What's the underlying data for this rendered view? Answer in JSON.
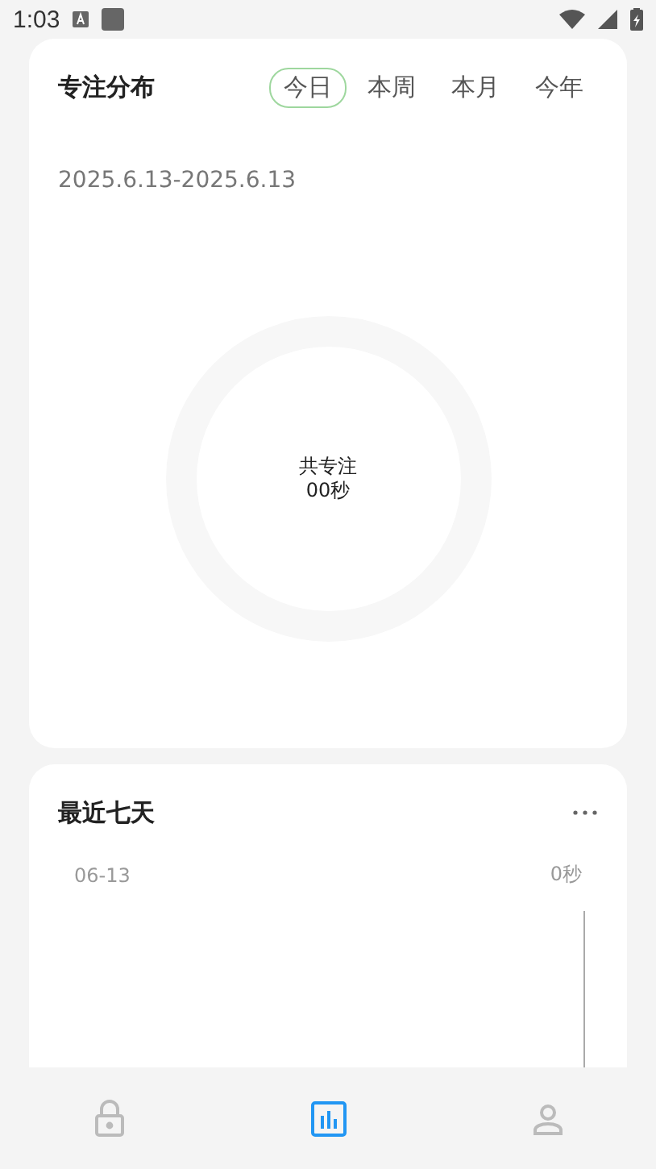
{
  "status_bar": {
    "time": "1:03"
  },
  "focus_card": {
    "title": "专注分布",
    "tabs": [
      {
        "label": "今日",
        "selected": true
      },
      {
        "label": "本周",
        "selected": false
      },
      {
        "label": "本月",
        "selected": false
      },
      {
        "label": "今年",
        "selected": false
      }
    ],
    "date_range": "2025.6.13-2025.6.13",
    "ring_label": "共专注",
    "ring_value": "00秒"
  },
  "recent_card": {
    "title": "最近七天",
    "rows": [
      {
        "date": "06-13",
        "value": "0秒"
      }
    ]
  },
  "bottom_nav": [
    {
      "kind": "lock",
      "selected": false
    },
    {
      "kind": "stats",
      "selected": true
    },
    {
      "kind": "profile",
      "selected": false
    }
  ]
}
